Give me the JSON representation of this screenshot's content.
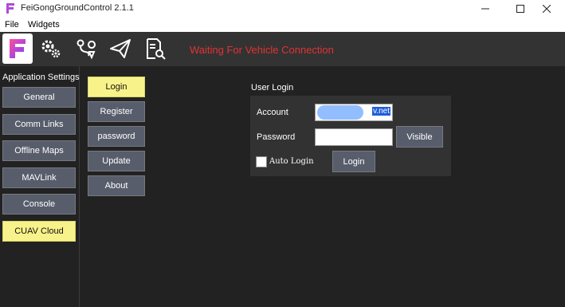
{
  "window": {
    "title": "FeiGongGroundControl 2.1.1"
  },
  "menu": {
    "file": "File",
    "widgets": "Widgets"
  },
  "toolbar": {
    "icons": [
      "app-logo-icon",
      "gear-icon",
      "route-pin-icon",
      "paper-plane-icon",
      "document-search-icon"
    ],
    "status": "Waiting For Vehicle Connection"
  },
  "sidebar": {
    "title": "Application Settings",
    "items": [
      {
        "label": "General"
      },
      {
        "label": "Comm Links"
      },
      {
        "label": "Offline Maps"
      },
      {
        "label": "MAVLink"
      },
      {
        "label": "Console"
      },
      {
        "label": "CUAV Cloud",
        "active": true
      }
    ]
  },
  "submenu": {
    "items": [
      {
        "label": "Login",
        "active": true
      },
      {
        "label": "Register"
      },
      {
        "label": "password"
      },
      {
        "label": "Update"
      },
      {
        "label": "About"
      }
    ]
  },
  "login": {
    "title": "User Login",
    "account_label": "Account",
    "account_value_visible": "v.net",
    "password_label": "Password",
    "password_value": "",
    "visible_button": "Visible",
    "auto_login_label": "Auto Login",
    "login_button": "Login"
  },
  "colors": {
    "accent_yellow": "#f8f28a",
    "button_gray": "#585d6b",
    "status_red": "#e23333",
    "background": "#222222"
  }
}
